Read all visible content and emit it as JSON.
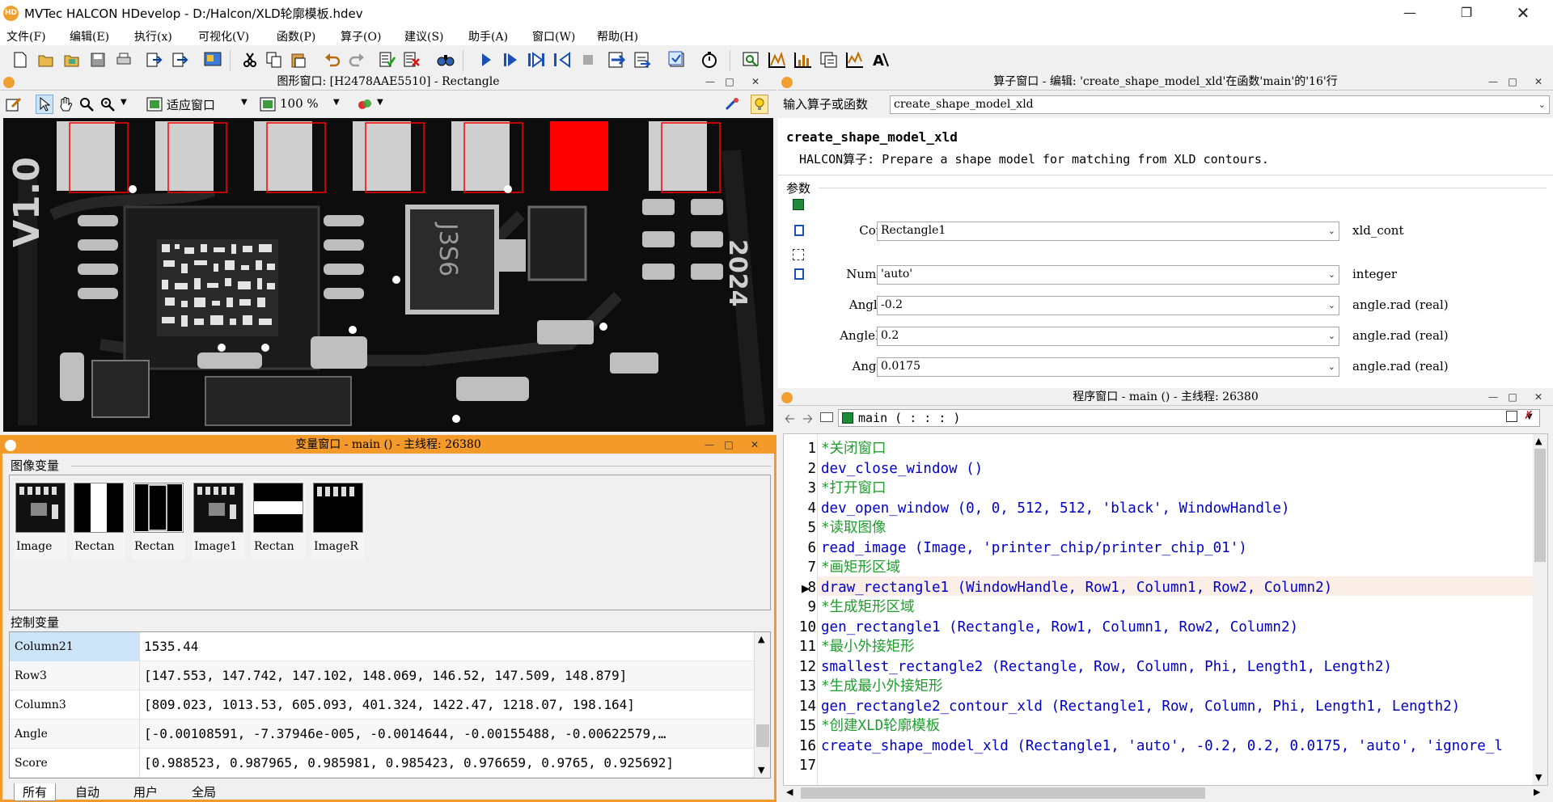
{
  "app": {
    "logo_text": "HD",
    "title": "MVTec HALCON HDevelop - D:/Halcon/XLD轮廓模板.hdev"
  },
  "menu": [
    "文件(F)",
    "编辑(E)",
    "执行(x)",
    "可视化(V)",
    "函数(P)",
    "算子(O)",
    "建议(S)",
    "助手(A)",
    "窗口(W)",
    "帮助(H)"
  ],
  "graphics_window": {
    "title": "图形窗口: [H2478AAE5510] - Rectangle",
    "fit_label": "适应窗口",
    "zoom_label": "100 %"
  },
  "operator_window": {
    "title": "算子窗口 - 编辑: 'create_shape_model_xld'在函数'main'的'16'行",
    "input_label": "输入算子或函数",
    "input_value": "create_shape_model_xld",
    "op_name": "create_shape_model_xld",
    "op_desc": "HALCON算子: Prepare a shape model for matching from XLD contours.",
    "params_label": "参数",
    "params": [
      {
        "name": "Contours",
        "value": "Rectangle1",
        "type": "xld_cont"
      },
      {
        "name": "NumLevels",
        "value": "'auto'",
        "type": "integer"
      },
      {
        "name": "AngleStart",
        "value": "-0.2",
        "type": "angle.rad (real)"
      },
      {
        "name": "AngleExtent",
        "value": "0.2",
        "type": "angle.rad (real)"
      },
      {
        "name": "AngleStep",
        "value": "0.0175",
        "type": "angle.rad (real)"
      }
    ]
  },
  "variable_window": {
    "title": "变量窗口 - main () - 主线程: 26380",
    "iconic_label": "图像变量",
    "iconic_vars": [
      "Image",
      "Rectan",
      "Rectan",
      "Image1",
      "Rectan",
      "ImageR"
    ],
    "control_label": "控制变量",
    "control_vars": [
      {
        "name": "Column21",
        "value": "1535.44"
      },
      {
        "name": "Row3",
        "value": "[147.553, 147.742, 147.102, 148.069, 146.52, 147.509, 148.879]"
      },
      {
        "name": "Column3",
        "value": "[809.023, 1013.53, 605.093, 401.324, 1422.47, 1218.07, 198.164]"
      },
      {
        "name": "Angle",
        "value": "[-0.00108591, -7.37946e-005, -0.0014644, -0.00155488, -0.00622579,…"
      },
      {
        "name": "Score",
        "value": "[0.988523, 0.987965, 0.985981, 0.985423, 0.976659, 0.9765, 0.925692]"
      }
    ],
    "tabs": [
      "所有",
      "自动",
      "用户",
      "全局"
    ]
  },
  "program_window": {
    "title": "程序窗口 - main () - 主线程: 26380",
    "procedure": "main ( : : : )",
    "current_line": 10,
    "lines": [
      {
        "n": "1",
        "text": "*关闭窗口",
        "kind": "comment"
      },
      {
        "n": "2",
        "text": "dev_close_window ()",
        "kind": "code"
      },
      {
        "n": "3",
        "text": "*打开窗口",
        "kind": "comment"
      },
      {
        "n": "4",
        "text": "dev_open_window (0, 0, 512, 512, 'black', WindowHandle)",
        "kind": "code"
      },
      {
        "n": "5",
        "text": "*读取图像",
        "kind": "comment"
      },
      {
        "n": "6",
        "text": "read_image (Image, 'printer_chip/printer_chip_01')",
        "kind": "code"
      },
      {
        "n": "7",
        "text": "*画矩形区域",
        "kind": "comment"
      },
      {
        "n": "8",
        "text": "draw_rectangle1 (WindowHandle, Row1, Column1, Row2, Column2)",
        "kind": "code"
      },
      {
        "n": "9",
        "text": "*生成矩形区域",
        "kind": "comment"
      },
      {
        "n": "10",
        "text": "gen_rectangle1 (Rectangle, Row1, Column1, Row2, Column2)",
        "kind": "code"
      },
      {
        "n": "11",
        "text": "*最小外接矩形",
        "kind": "comment"
      },
      {
        "n": "12",
        "text": "smallest_rectangle2 (Rectangle, Row, Column, Phi, Length1, Length2)",
        "kind": "code"
      },
      {
        "n": "13",
        "text": "*生成最小外接矩形",
        "kind": "comment"
      },
      {
        "n": "14",
        "text": "gen_rectangle2_contour_xld (Rectangle1, Row, Column, Phi, Length1, Length2)",
        "kind": "code"
      },
      {
        "n": "15",
        "text": "*创建XLD轮廓模板",
        "kind": "comment"
      },
      {
        "n": "16",
        "text": "create_shape_model_xld (Rectangle1, 'auto', -0.2, 0.2, 0.0175, 'auto', 'ignore_l",
        "kind": "code"
      },
      {
        "n": "17",
        "text": "",
        "kind": "code"
      }
    ]
  },
  "image_labels": {
    "left": "V1.0",
    "chip": "J3S6",
    "right": "2024"
  },
  "colors": {
    "accent_orange": "#f0a030",
    "comment_green": "#1f9e2e",
    "operator_blue": "#0000c8",
    "roi_red": "#ff0000",
    "selection_blue": "#cce4f7"
  }
}
